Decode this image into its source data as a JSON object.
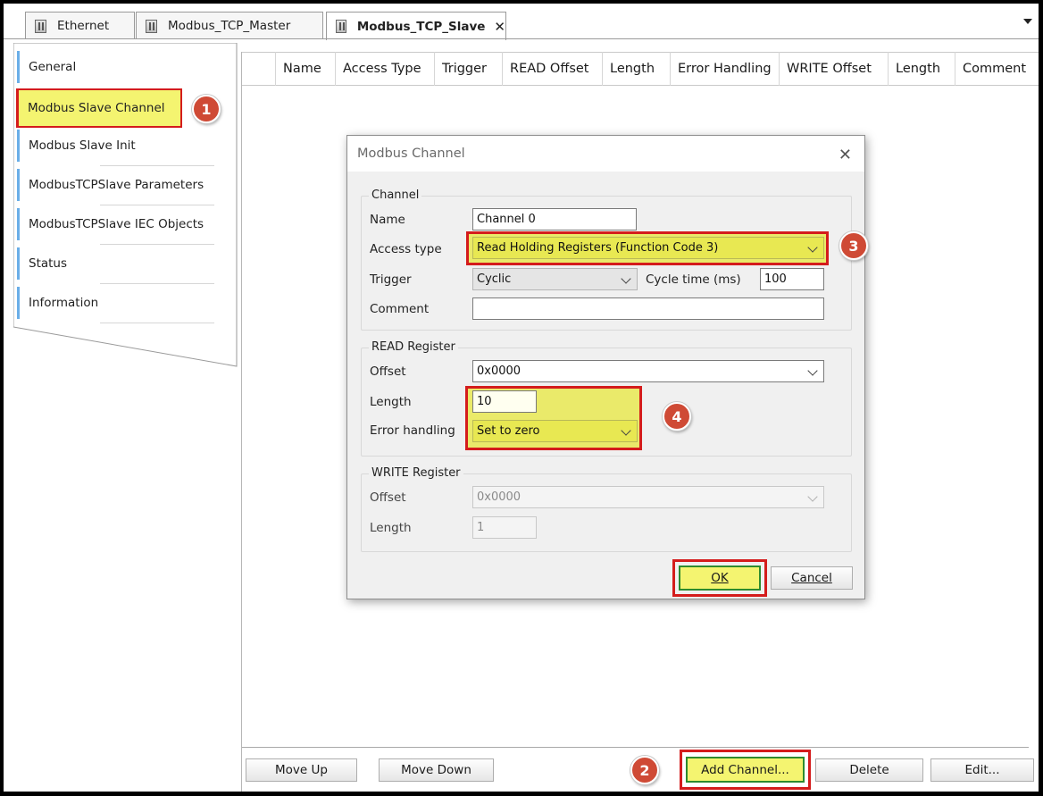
{
  "tabs": [
    {
      "label": "Ethernet"
    },
    {
      "label": "Modbus_TCP_Master"
    },
    {
      "label": "Modbus_TCP_Slave",
      "close": "✕"
    }
  ],
  "sidebar": {
    "items": [
      {
        "label": "General"
      },
      {
        "label": "Modbus Slave Channel"
      },
      {
        "label": "Modbus Slave Init"
      },
      {
        "label": "ModbusTCPSlave Parameters"
      },
      {
        "label": "ModbusTCPSlave IEC Objects"
      },
      {
        "label": "Status"
      },
      {
        "label": "Information"
      }
    ]
  },
  "table": {
    "columns": [
      "Name",
      "Access Type",
      "Trigger",
      "READ Offset",
      "Length",
      "Error Handling",
      "WRITE Offset",
      "Length",
      "Comment"
    ]
  },
  "buttons": {
    "move_up": "Move Up",
    "move_down": "Move Down",
    "add_channel": "Add Channel...",
    "delete": "Delete",
    "edit": "Edit..."
  },
  "badges": [
    "1",
    "2",
    "3",
    "4"
  ],
  "dialog": {
    "title": "Modbus Channel",
    "close": "✕",
    "channel": {
      "group": "Channel",
      "name_label": "Name",
      "name_value": "Channel 0",
      "access_label": "Access type",
      "access_value": "Read Holding Registers (Function Code 3)",
      "trigger_label": "Trigger",
      "trigger_value": "Cyclic",
      "cycle_label": "Cycle time (ms)",
      "cycle_value": "100",
      "comment_label": "Comment",
      "comment_value": ""
    },
    "read": {
      "group": "READ Register",
      "offset_label": "Offset",
      "offset_value": "0x0000",
      "length_label": "Length",
      "length_value": "10",
      "error_label": "Error handling",
      "error_value": "Set to zero"
    },
    "write": {
      "group": "WRITE Register",
      "offset_label": "Offset",
      "offset_value": "0x0000",
      "length_label": "Length",
      "length_value": "1"
    },
    "ok": "OK",
    "cancel": "Cancel"
  },
  "colors": {
    "highlight_red": "#d41c1c",
    "highlight_yellow": "#f4f470",
    "badge": "#cf4a35",
    "accent_blue": "#6aaee8"
  }
}
